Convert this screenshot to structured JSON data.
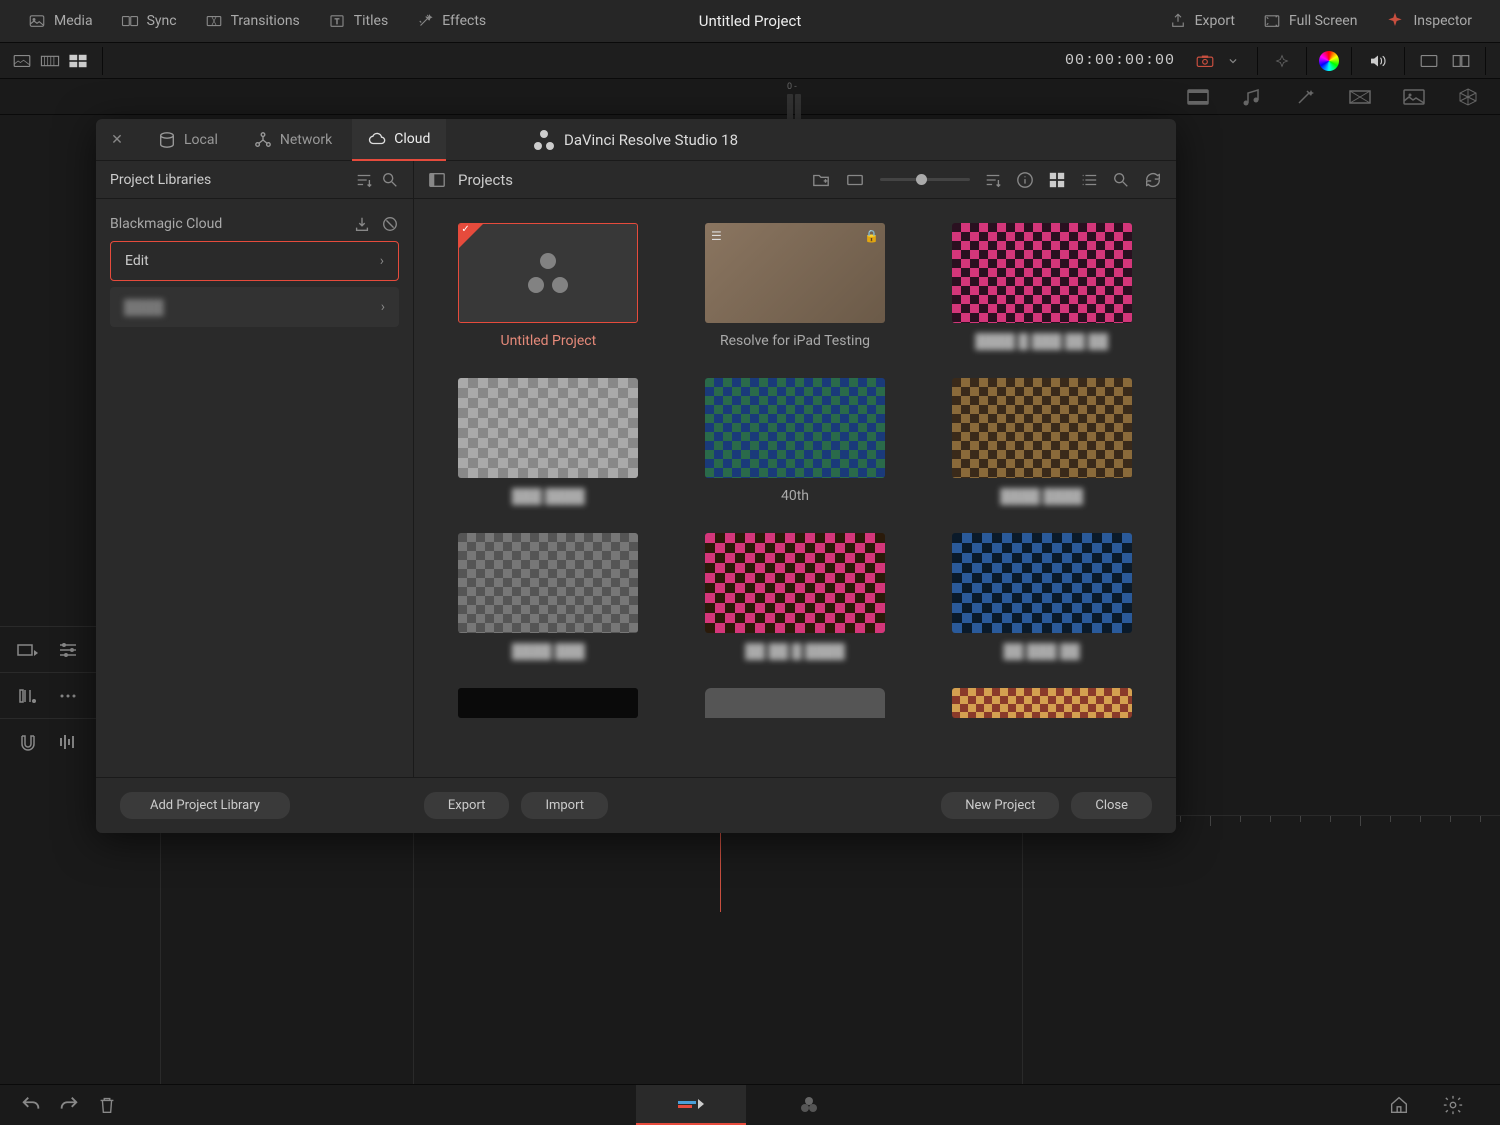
{
  "topBar": {
    "media": "Media",
    "sync": "Sync",
    "transitions": "Transitions",
    "titles": "Titles",
    "effects": "Effects",
    "title": "Untitled Project",
    "export": "Export",
    "fullScreen": "Full Screen",
    "inspector": "Inspector"
  },
  "toolbar": {
    "timecode": "00:00:00:00",
    "vuLabel": "0 -"
  },
  "modal": {
    "brand": "DaVinci Resolve Studio 18",
    "tabs": {
      "local": "Local",
      "network": "Network",
      "cloud": "Cloud"
    },
    "sidebar": {
      "header": "Project Libraries",
      "cloudLabel": "Blackmagic Cloud",
      "items": [
        "Edit",
        "████"
      ]
    },
    "main": {
      "header": "Projects"
    },
    "projects": [
      {
        "name": "Untitled Project",
        "selected": true,
        "blank": true
      },
      {
        "name": "Resolve for iPad Testing",
        "locked": true,
        "notes": true
      },
      {
        "name": "████ █ ███ ██ ██"
      },
      {
        "name": "███ ████"
      },
      {
        "name": "40th"
      },
      {
        "name": "████ ████"
      },
      {
        "name": "████ ███"
      },
      {
        "name": "██ ██ █ ████"
      },
      {
        "name": "██ ███ ██"
      },
      {
        "name": ""
      },
      {
        "name": ""
      },
      {
        "name": ""
      }
    ],
    "footer": {
      "addLibrary": "Add Project Library",
      "export": "Export",
      "import": "Import",
      "newProject": "New Project",
      "close": "Close"
    }
  }
}
